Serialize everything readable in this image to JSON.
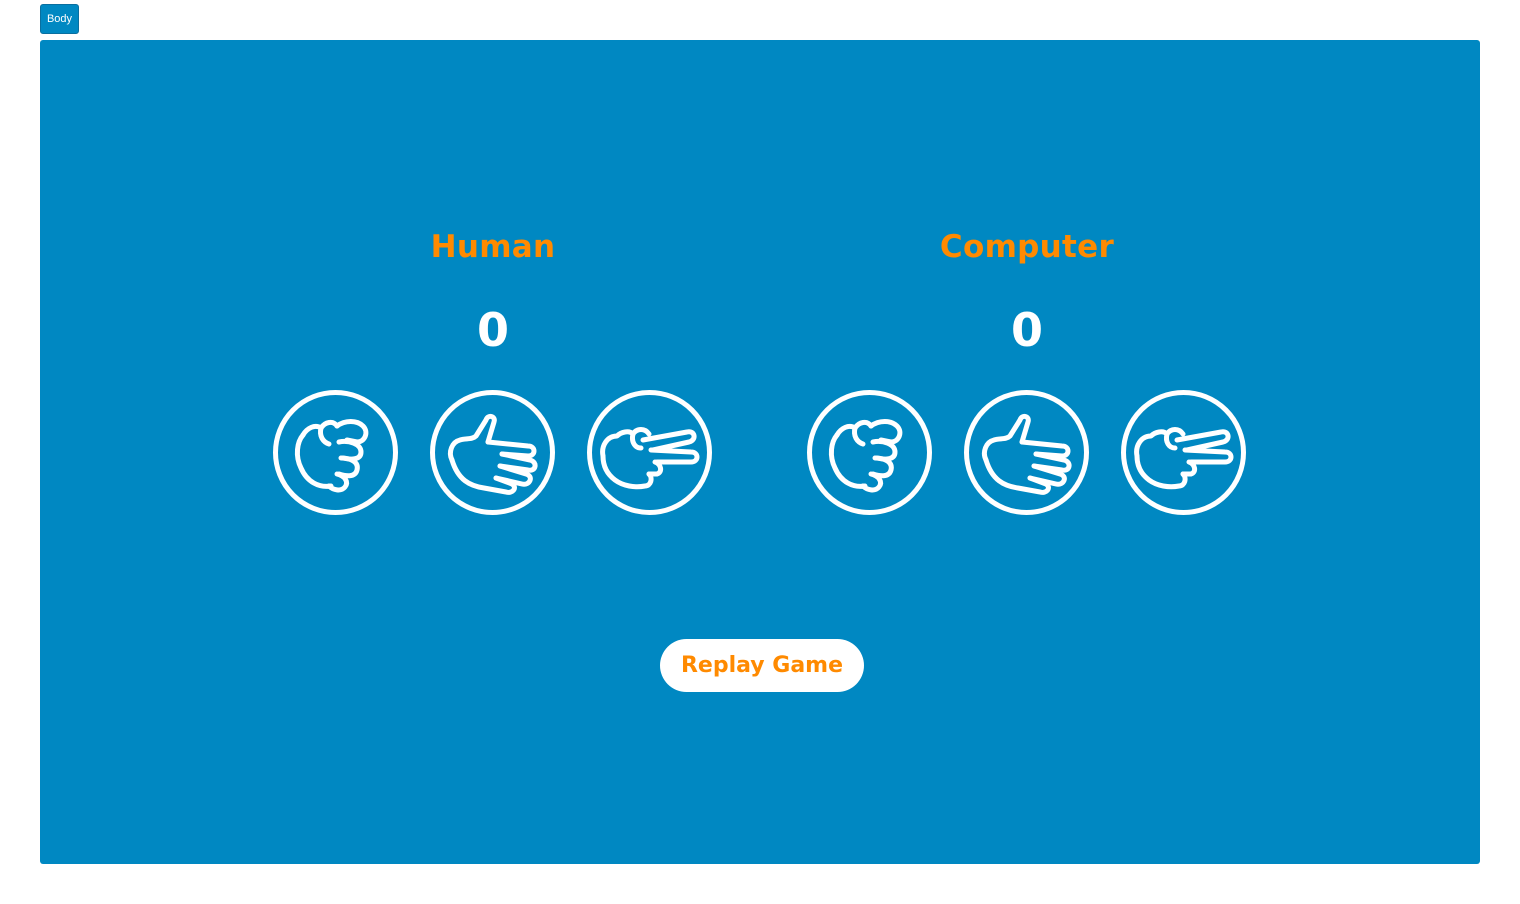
{
  "devtools": {
    "tag_label": "Body"
  },
  "colors": {
    "stage_background": "#0088c2",
    "accent": "#ff8a00",
    "icon_stroke": "#ffffff"
  },
  "players": [
    {
      "name": "Human",
      "score": "0",
      "choices": [
        {
          "icon": "rock-hand-icon"
        },
        {
          "icon": "paper-hand-icon"
        },
        {
          "icon": "scissors-hand-icon"
        }
      ]
    },
    {
      "name": "Computer",
      "score": "0",
      "choices": [
        {
          "icon": "rock-hand-icon"
        },
        {
          "icon": "paper-hand-icon"
        },
        {
          "icon": "scissors-hand-icon"
        }
      ]
    }
  ],
  "controls": {
    "replay_label": "Replay Game"
  }
}
